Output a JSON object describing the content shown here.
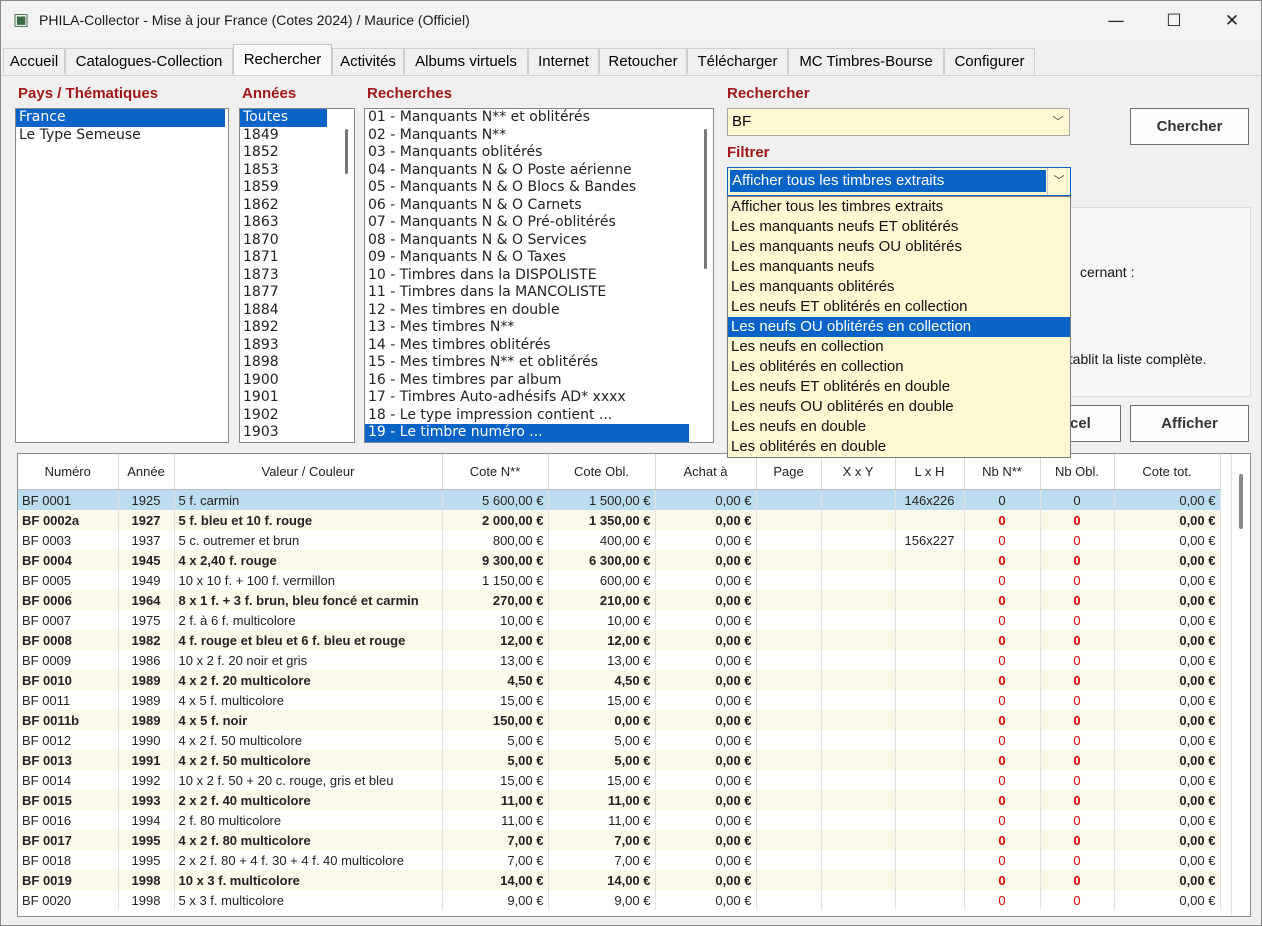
{
  "window": {
    "title": "PHILA-Collector - Mise à jour France (Cotes 2024) / Maurice (Officiel)",
    "minimize": "—",
    "maximize": "☐",
    "close": "✕"
  },
  "tabs": [
    "Accueil",
    "Catalogues-Collection",
    "Rechercher",
    "Activités",
    "Albums virtuels",
    "Internet",
    "Retoucher",
    "Télécharger",
    "MC Timbres-Bourse",
    "Configurer"
  ],
  "active_tab": "Rechercher",
  "pays": {
    "label": "Pays / Thématiques",
    "items": [
      "France",
      "Le Type Semeuse"
    ],
    "selected": "France"
  },
  "annees": {
    "label": "Années",
    "items": [
      "Toutes",
      "1849",
      "1852",
      "1853",
      "1859",
      "1862",
      "1863",
      "1870",
      "1871",
      "1873",
      "1877",
      "1884",
      "1892",
      "1893",
      "1898",
      "1900",
      "1901",
      "1902",
      "1903"
    ],
    "selected": "Toutes"
  },
  "recherches": {
    "label": "Recherches",
    "items": [
      "01 - Manquants N** et oblitérés",
      "02 - Manquants N**",
      "03 - Manquants oblitérés",
      "04 - Manquants N & O Poste aérienne",
      "05 - Manquants N & O Blocs & Bandes",
      "06 - Manquants N & O Carnets",
      "07 - Manquants N & O Pré-oblitérés",
      "08 - Manquants N & O Services",
      "09 - Manquants N & O Taxes",
      "10 - Timbres dans la DISPOLISTE",
      "11 - Timbres dans la MANCOLISTE",
      "12 - Mes timbres en double",
      "13 - Mes timbres N**",
      "14 - Mes timbres oblitérés",
      "15 - Mes timbres N** et oblitérés",
      "16 - Mes timbres par album",
      "17 - Timbres Auto-adhésifs AD* xxxx",
      "18 - Le type impression contient ...",
      "19 - Le timbre numéro ..."
    ],
    "selected": "19 - Le timbre numéro ..."
  },
  "rechercher": {
    "label": "Rechercher",
    "value": "BF",
    "button": "Chercher"
  },
  "filtrer": {
    "label": "Filtrer",
    "value": "Afficher tous les timbres extraits",
    "options": [
      "Afficher tous les timbres extraits",
      "Les manquants neufs ET oblitérés",
      "Les manquants neufs OU oblitérés",
      "Les manquants neufs",
      "Les manquants oblitérés",
      "Les neufs ET oblitérés en collection",
      "Les neufs OU oblitérés en collection",
      "Les neufs en collection",
      "Les oblitérés en collection",
      "Les neufs ET oblitérés en double",
      "Les neufs OU oblitérés en double",
      "Les neufs en double",
      "Les oblitérés en double"
    ],
    "highlighted": "Les neufs OU oblitérés en collection"
  },
  "info": {
    "line1": "cernant :",
    "line2": "établit la liste complète."
  },
  "buttons": {
    "cancel_partial": "cel",
    "afficher": "Afficher"
  },
  "table": {
    "columns": [
      "Numéro",
      "Année",
      "Valeur / Couleur",
      "Cote N**",
      "Cote Obl.",
      "Achat à",
      "Page",
      "X x Y",
      "L x H",
      "Nb N**",
      "Nb Obl.",
      "Cote tot."
    ],
    "rows": [
      [
        "BF 0001",
        "1925",
        "5 f. carmin",
        "5 600,00 €",
        "1 500,00 €",
        "0,00 €",
        "",
        "",
        "146x226",
        "0",
        "0",
        "0,00 €"
      ],
      [
        "BF 0002a",
        "1927",
        "5 f. bleu et 10 f. rouge",
        "2 000,00 €",
        "1 350,00 €",
        "0,00 €",
        "",
        "",
        "",
        "0",
        "0",
        "0,00 €"
      ],
      [
        "BF 0003",
        "1937",
        "5 c. outremer et brun",
        "800,00 €",
        "400,00 €",
        "0,00 €",
        "",
        "",
        "156x227",
        "0",
        "0",
        "0,00 €"
      ],
      [
        "BF 0004",
        "1945",
        "4 x 2,40 f. rouge",
        "9 300,00 €",
        "6 300,00 €",
        "0,00 €",
        "",
        "",
        "",
        "0",
        "0",
        "0,00 €"
      ],
      [
        "BF 0005",
        "1949",
        "10 x 10 f. + 100 f. vermillon",
        "1 150,00 €",
        "600,00 €",
        "0,00 €",
        "",
        "",
        "",
        "0",
        "0",
        "0,00 €"
      ],
      [
        "BF 0006",
        "1964",
        "8 x 1 f. + 3 f. brun, bleu foncé et carmin",
        "270,00 €",
        "210,00 €",
        "0,00 €",
        "",
        "",
        "",
        "0",
        "0",
        "0,00 €"
      ],
      [
        "BF 0007",
        "1975",
        "2 f. à 6 f. multicolore",
        "10,00 €",
        "10,00 €",
        "0,00 €",
        "",
        "",
        "",
        "0",
        "0",
        "0,00 €"
      ],
      [
        "BF 0008",
        "1982",
        "4 f. rouge et bleu et 6 f. bleu et rouge",
        "12,00 €",
        "12,00 €",
        "0,00 €",
        "",
        "",
        "",
        "0",
        "0",
        "0,00 €"
      ],
      [
        "BF 0009",
        "1986",
        "10 x 2 f. 20 noir et gris",
        "13,00 €",
        "13,00 €",
        "0,00 €",
        "",
        "",
        "",
        "0",
        "0",
        "0,00 €"
      ],
      [
        "BF 0010",
        "1989",
        "4 x 2 f. 20 multicolore",
        "4,50 €",
        "4,50 €",
        "0,00 €",
        "",
        "",
        "",
        "0",
        "0",
        "0,00 €"
      ],
      [
        "BF 0011",
        "1989",
        "4 x 5 f. multicolore",
        "15,00 €",
        "15,00 €",
        "0,00 €",
        "",
        "",
        "",
        "0",
        "0",
        "0,00 €"
      ],
      [
        "BF 0011b",
        "1989",
        "4 x 5 f. noir",
        "150,00 €",
        "0,00 €",
        "0,00 €",
        "",
        "",
        "",
        "0",
        "0",
        "0,00 €"
      ],
      [
        "BF 0012",
        "1990",
        "4 x 2 f. 50 multicolore",
        "5,00 €",
        "5,00 €",
        "0,00 €",
        "",
        "",
        "",
        "0",
        "0",
        "0,00 €"
      ],
      [
        "BF 0013",
        "1991",
        "4 x 2 f. 50 multicolore",
        "5,00 €",
        "5,00 €",
        "0,00 €",
        "",
        "",
        "",
        "0",
        "0",
        "0,00 €"
      ],
      [
        "BF 0014",
        "1992",
        "10 x 2 f. 50 + 20 c. rouge, gris et bleu",
        "15,00 €",
        "15,00 €",
        "0,00 €",
        "",
        "",
        "",
        "0",
        "0",
        "0,00 €"
      ],
      [
        "BF 0015",
        "1993",
        "2 x 2 f. 40 multicolore",
        "11,00 €",
        "11,00 €",
        "0,00 €",
        "",
        "",
        "",
        "0",
        "0",
        "0,00 €"
      ],
      [
        "BF 0016",
        "1994",
        "2 f. 80 multicolore",
        "11,00 €",
        "11,00 €",
        "0,00 €",
        "",
        "",
        "",
        "0",
        "0",
        "0,00 €"
      ],
      [
        "BF 0017",
        "1995",
        "4 x 2 f. 80 multicolore",
        "7,00 €",
        "7,00 €",
        "0,00 €",
        "",
        "",
        "",
        "0",
        "0",
        "0,00 €"
      ],
      [
        "BF 0018",
        "1995",
        "2 x 2 f. 80 + 4 f. 30 + 4 f. 40 multicolore",
        "7,00 €",
        "7,00 €",
        "0,00 €",
        "",
        "",
        "",
        "0",
        "0",
        "0,00 €"
      ],
      [
        "BF 0019",
        "1998",
        "10 x 3 f. multicolore",
        "14,00 €",
        "14,00 €",
        "0,00 €",
        "",
        "",
        "",
        "0",
        "0",
        "0,00 €"
      ],
      [
        "BF 0020",
        "1998",
        "5 x 3 f. multicolore",
        "9,00 €",
        "9,00 €",
        "0,00 €",
        "",
        "",
        "",
        "0",
        "0",
        "0,00 €"
      ]
    ],
    "bold_rows": [
      1,
      3,
      5,
      7,
      9,
      11,
      13,
      15,
      17,
      19
    ],
    "selected_row": 0
  }
}
